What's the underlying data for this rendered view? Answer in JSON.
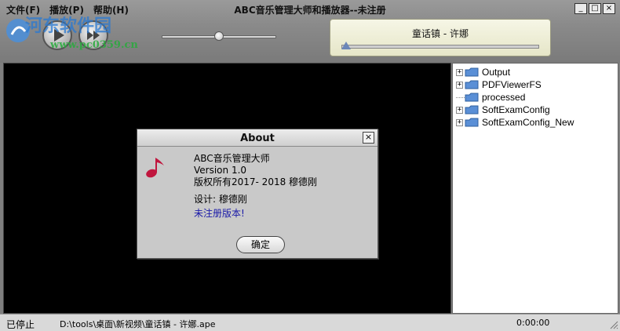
{
  "window": {
    "title": "ABC音乐管理大师和播放器--未注册",
    "controls": [
      "_",
      "□",
      "×"
    ]
  },
  "menu": [
    "文件(F)",
    "播放(P)",
    "帮助(H)"
  ],
  "watermark": {
    "text": "河东软件园",
    "url": "www.pc0359.cn"
  },
  "player": {
    "buttons": [
      "play",
      "next"
    ],
    "volume": 0.5,
    "progress": 0.0,
    "now_playing": "童话镇 - 许娜"
  },
  "tree": {
    "items": [
      {
        "label": "Output",
        "expandable": true
      },
      {
        "label": "PDFViewerFS",
        "expandable": true
      },
      {
        "label": "processed",
        "expandable": false
      },
      {
        "label": "SoftExamConfig",
        "expandable": true
      },
      {
        "label": "SoftExamConfig_New",
        "expandable": true
      }
    ]
  },
  "about": {
    "title": "About",
    "close": "×",
    "app_name": "ABC音乐管理大师",
    "version": "Version 1.0",
    "copyright": "版权所有2017- 2018 穆德刚",
    "designer": "设计: 穆德刚",
    "unregistered": "未注册版本!",
    "ok": "确定"
  },
  "status": {
    "state": "已停止",
    "path": "D:\\tools\\桌面\\新视频\\童话镇 - 许娜.ape",
    "time": "0:00:00"
  },
  "colors": {
    "accent_blue": "#1a1aa8",
    "note_red": "#c0163e",
    "folder_blue": "#5a8fd6"
  },
  "icons": {
    "app": "app-logo-icon",
    "note": "music-note-icon",
    "folder": "folder-icon"
  }
}
